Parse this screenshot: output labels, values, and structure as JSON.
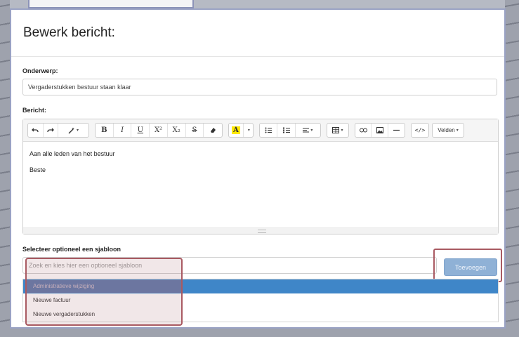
{
  "modal": {
    "title": "Bewerk bericht:",
    "subject_label": "Onderwerp:",
    "subject_value": "Vergaderstukken bestuur staan klaar",
    "message_label": "Bericht:",
    "message_lines": [
      "Aan alle leden van het bestuur",
      "Beste"
    ],
    "template_label": "Selecteer optioneel een sjabloon",
    "template_placeholder": "Zoek en kies hier een optioneel sjabloon",
    "apply_button": "Toevoegen",
    "template_options": [
      "Administratieve wijziging",
      "Nieuwe factuur",
      "Nieuwe vergaderstukken"
    ],
    "active_option_index": 0
  },
  "toolbar": {
    "undo_icon": "undo-icon",
    "redo_icon": "redo-icon",
    "magic_icon": "magic-wand-icon",
    "bold": "B",
    "italic": "I",
    "underline": "U",
    "superscript": "X²",
    "subscript": "X₂",
    "strike": "S",
    "eraser_icon": "eraser-icon",
    "color_letter": "A",
    "fields_label": "Velden"
  },
  "colors": {
    "primary_active": "#3f86c8",
    "apply_button": "#8fb1d6",
    "highlight_border": "#a95a62"
  }
}
